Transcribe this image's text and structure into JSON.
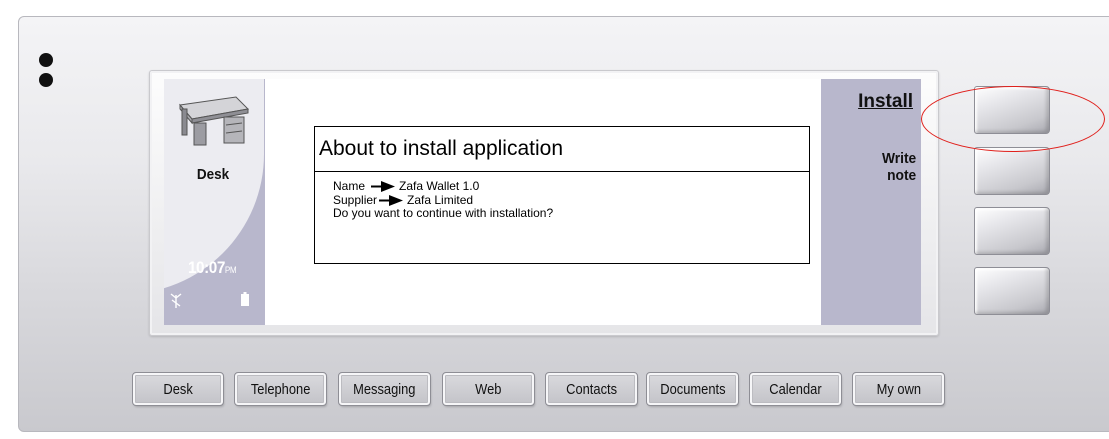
{
  "status_panel": {
    "app_name": "Desk",
    "time": "10:07",
    "time_suffix": "PM",
    "icons": [
      "desk-icon",
      "signal-icon",
      "battery-icon"
    ]
  },
  "dialog": {
    "title": "About to install application",
    "name_label": "Name",
    "name_value": "Zafa Wallet 1.0",
    "supplier_label": "Supplier",
    "supplier_value": "Zafa Limited",
    "question": "Do you want to continue with installation?"
  },
  "commands": {
    "install": "Install",
    "write_note_line1": "Write",
    "write_note_line2": "note"
  },
  "app_bar": [
    {
      "label": "Desk"
    },
    {
      "label": "Telephone"
    },
    {
      "label": "Messaging"
    },
    {
      "label": "Web"
    },
    {
      "label": "Contacts"
    },
    {
      "label": "Documents"
    },
    {
      "label": "Calendar"
    },
    {
      "label": "My own"
    }
  ],
  "colors": {
    "panel": "#b8b7cc",
    "highlight": "#e0201c"
  }
}
